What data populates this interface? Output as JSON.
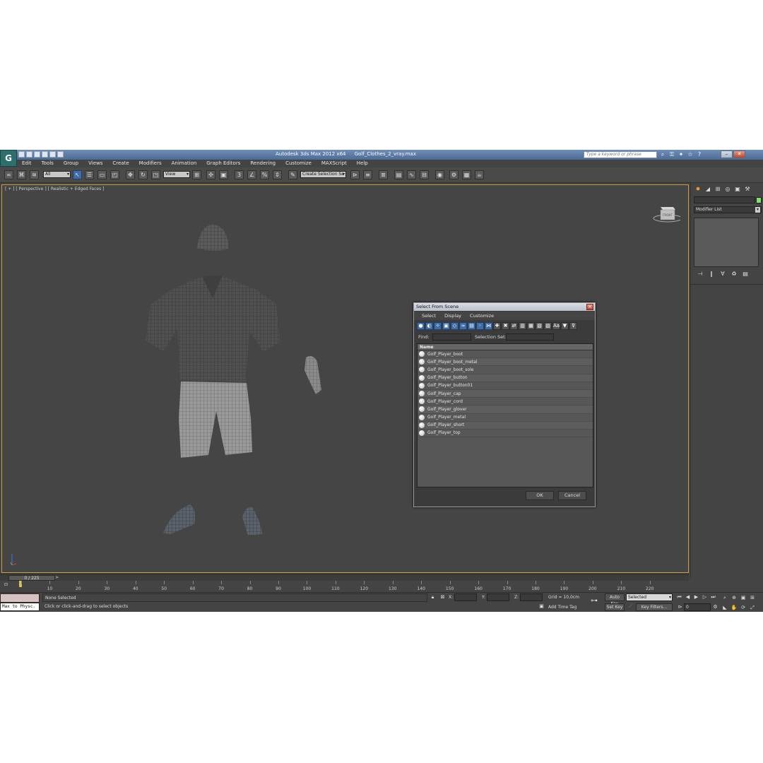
{
  "window": {
    "app_title": "Autodesk 3ds Max  2012 x64",
    "file_name": "Golf_Clothes_2_vray.max",
    "search_placeholder": "Type a keyword or phrase",
    "logo_letter": "G"
  },
  "menu": [
    "Edit",
    "Tools",
    "Group",
    "Views",
    "Create",
    "Modifiers",
    "Animation",
    "Graph Editors",
    "Rendering",
    "Customize",
    "MAXScript",
    "Help"
  ],
  "toolbar": {
    "selection_filter": "All",
    "reference_coord": "View",
    "named_selection": "Create Selection Se"
  },
  "viewport": {
    "label": "[ + ] [ Perspective ] [ Realistic + Edged Faces ]",
    "viewcube_label": "FRONT"
  },
  "dialog": {
    "title": "Select From Scene",
    "menu": [
      "Select",
      "Display",
      "Customize"
    ],
    "find_label": "Find:",
    "selection_set_label": "Selection Set:",
    "column_header": "Name",
    "objects": [
      "Golf_Player_boot",
      "Golf_Player_boot_metal",
      "Golf_Player_boot_sole",
      "Golf_Player_button",
      "Golf_Player_button01",
      "Golf_Player_cap",
      "Golf_Player_cord",
      "Golf_Player_glover",
      "Golf_Player_metal",
      "Golf_Player_short",
      "Golf_Player_top"
    ],
    "ok_label": "OK",
    "cancel_label": "Cancel"
  },
  "command_panel": {
    "modifier_list": "Modifier List",
    "object_color": "#86e06e"
  },
  "timeline": {
    "frame_display": "0 / 225",
    "ticks": [
      "0",
      "10",
      "20",
      "30",
      "40",
      "50",
      "60",
      "70",
      "80",
      "90",
      "100",
      "110",
      "120",
      "130",
      "140",
      "150",
      "160",
      "170",
      "180",
      "190",
      "200",
      "210",
      "220"
    ]
  },
  "status": {
    "maxscript_text": "Max to Physc.",
    "selection_status": "None Selected",
    "prompt": "Click or click-and-drag to select objects",
    "x_label": "X:",
    "y_label": "Y:",
    "z_label": "Z:",
    "grid": "Grid = 10,0cm",
    "add_time_tag": "Add Time Tag",
    "auto_key": "Auto Key",
    "set_key": "Set Key",
    "key_mode": "Selected",
    "key_filters": "Key Filters...",
    "frame": "0"
  },
  "colors": {
    "viewport_border": "#c8a03a",
    "active_button": "#3d6ea8",
    "title_bar": "#5a7aa8"
  }
}
